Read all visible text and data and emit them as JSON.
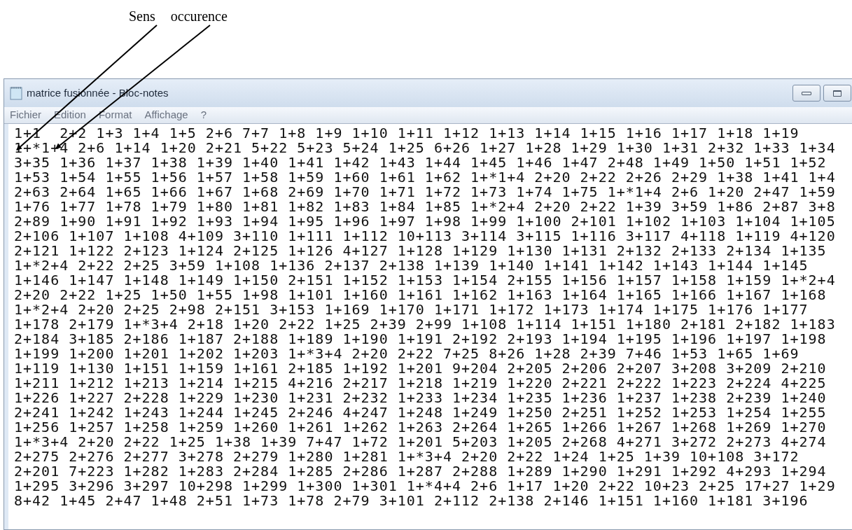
{
  "annotations": [
    {
      "label": "Sens"
    },
    {
      "label": "occurence"
    }
  ],
  "window": {
    "title": "matrice fusionnée - Bloc-notes"
  },
  "menu": [
    {
      "label": "Fichier"
    },
    {
      "label": "Edition"
    },
    {
      "label": "Format"
    },
    {
      "label": "Affichage"
    },
    {
      "label": "?"
    }
  ],
  "lines": [
    "1+1  2+2 1+3 1+4 1+5 2+6 7+7 1+8 1+9 1+10 1+11 1+12 1+13 1+14 1+15 1+16 1+17 1+18 1+19",
    "1+*1+4 2+6 1+14 1+20 2+21 5+22 5+23 5+24 1+25 6+26 1+27 1+28 1+29 1+30 1+31 2+32 1+33 1+34",
    "3+35 1+36 1+37 1+38 1+39 1+40 1+41 1+42 1+43 1+44 1+45 1+46 1+47 2+48 1+49 1+50 1+51 1+52",
    "1+53 1+54 1+55 1+56 1+57 1+58 1+59 1+60 1+61 1+62 1+*1+4 2+20 2+22 2+26 2+29 1+38 1+41 1+4",
    "2+63 2+64 1+65 1+66 1+67 1+68 2+69 1+70 1+71 1+72 1+73 1+74 1+75 1+*1+4 2+6 1+20 2+47 1+59",
    "1+76 1+77 1+78 1+79 1+80 1+81 1+82 1+83 1+84 1+85 1+*2+4 2+20 2+22 1+39 3+59 1+86 2+87 3+8",
    "2+89 1+90 1+91 1+92 1+93 1+94 1+95 1+96 1+97 1+98 1+99 1+100 2+101 1+102 1+103 1+104 1+105",
    "2+106 1+107 1+108 4+109 3+110 1+111 1+112 10+113 3+114 3+115 1+116 3+117 4+118 1+119 4+120",
    "2+121 1+122 2+123 1+124 2+125 1+126 4+127 1+128 1+129 1+130 1+131 2+132 2+133 2+134 1+135",
    "1+*2+4 2+22 2+25 3+59 1+108 1+136 2+137 2+138 1+139 1+140 1+141 1+142 1+143 1+144 1+145",
    "1+146 1+147 1+148 1+149 1+150 2+151 1+152 1+153 1+154 2+155 1+156 1+157 1+158 1+159 1+*2+4",
    "2+20 2+22 1+25 1+50 1+55 1+98 1+101 1+160 1+161 1+162 1+163 1+164 1+165 1+166 1+167 1+168",
    "1+*2+4 2+20 2+25 2+98 2+151 3+153 1+169 1+170 1+171 1+172 1+173 1+174 1+175 1+176 1+177",
    "1+178 2+179 1+*3+4 2+18 1+20 2+22 1+25 2+39 2+99 1+108 1+114 1+151 1+180 2+181 2+182 1+183",
    "2+184 3+185 2+186 1+187 2+188 1+189 1+190 1+191 2+192 2+193 1+194 1+195 1+196 1+197 1+198",
    "1+199 1+200 1+201 1+202 1+203 1+*3+4 2+20 2+22 7+25 8+26 1+28 2+39 7+46 1+53 1+65 1+69",
    "1+119 1+130 1+151 1+159 1+161 2+185 1+192 1+201 9+204 2+205 2+206 2+207 3+208 3+209 2+210",
    "1+211 1+212 1+213 1+214 1+215 4+216 2+217 1+218 1+219 1+220 2+221 2+222 1+223 2+224 4+225",
    "1+226 1+227 2+228 1+229 1+230 1+231 2+232 1+233 1+234 1+235 1+236 1+237 1+238 2+239 1+240",
    "2+241 1+242 1+243 1+244 1+245 2+246 4+247 1+248 1+249 1+250 2+251 1+252 1+253 1+254 1+255",
    "1+256 1+257 1+258 1+259 1+260 1+261 1+262 1+263 2+264 1+265 1+266 1+267 1+268 1+269 1+270",
    "1+*3+4 2+20 2+22 1+25 1+38 1+39 7+47 1+72 1+201 5+203 1+205 2+268 4+271 3+272 2+273 4+274",
    "2+275 2+276 2+277 3+278 2+279 1+280 1+281 1+*3+4 2+20 2+22 1+24 1+25 1+39 10+108 3+172",
    "2+201 7+223 1+282 1+283 2+284 1+285 2+286 1+287 2+288 1+289 1+290 1+291 1+292 4+293 1+294",
    "1+295 3+296 3+297 10+298 1+299 1+300 1+301 1+*4+4 2+6 1+17 1+20 2+22 10+23 2+25 17+27 1+29",
    "8+42 1+45 2+47 1+48 2+51 1+73 1+78 2+79 3+101 2+112 2+138 2+146 1+151 1+160 1+181 3+196"
  ]
}
